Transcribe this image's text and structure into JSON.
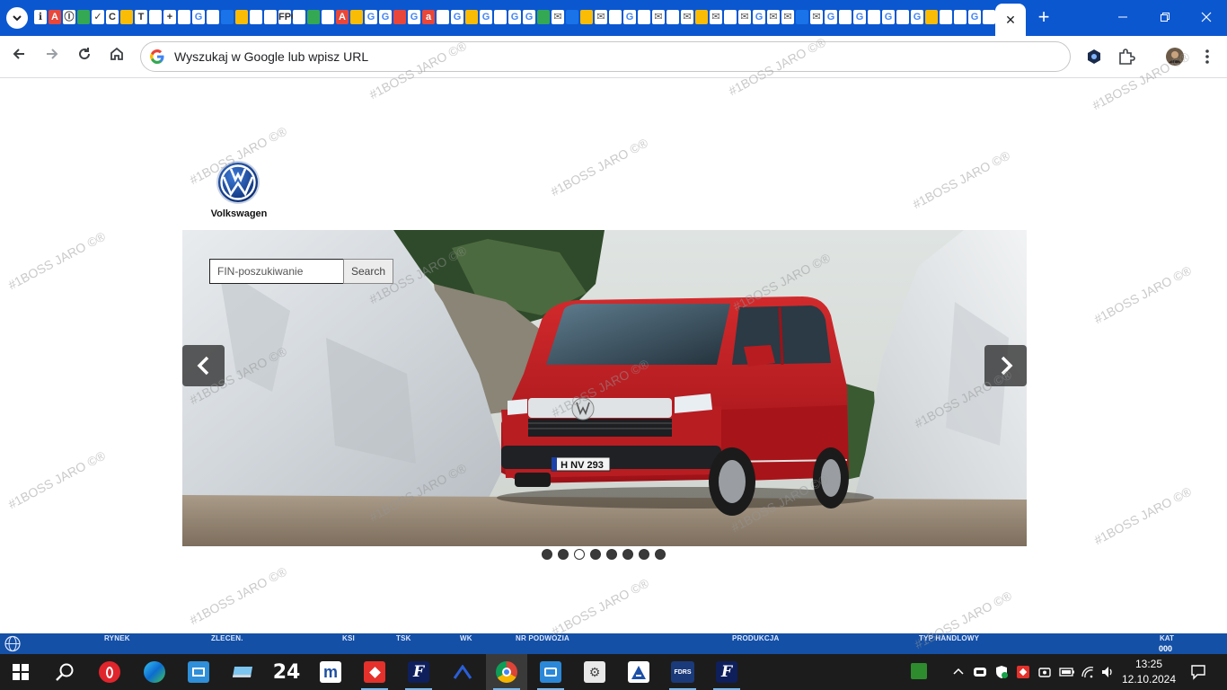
{
  "browser": {
    "address_bar_text": "Wyszukaj w Google lub wpisz URL",
    "tab_close": "✕",
    "new_tab": "+",
    "tab_favicons": [
      "ℹ",
      "A",
      "Ⓘ",
      "",
      "✓",
      "C",
      "",
      "T",
      "",
      "+",
      "",
      "G",
      "",
      "",
      "",
      "",
      "",
      "FPG",
      "",
      "",
      "",
      "A",
      "",
      "G",
      "G",
      "",
      "G",
      "a",
      "",
      "G",
      "",
      "G",
      "",
      "G",
      "G",
      "",
      "✉",
      "",
      "",
      "✉",
      "",
      "G",
      "",
      "✉",
      "",
      "✉",
      "",
      "✉",
      "",
      "✉",
      "G",
      "✉",
      "✉",
      "",
      "✉",
      "G",
      "",
      "G",
      "",
      "G",
      "",
      "G",
      "",
      "",
      "",
      "G",
      "",
      "",
      "",
      "G",
      "",
      "a",
      "o"
    ]
  },
  "page": {
    "brand_name": "Volkswagen",
    "search_placeholder": "FIN-poszukiwanie",
    "search_button": "Search",
    "carousel": {
      "slide_count": 8,
      "active_slide": 3,
      "plate_text": "H NV 293"
    }
  },
  "watermark": "#1BOSS JARO ©®",
  "status_bar": {
    "labels": [
      "RYNEK",
      "ZLECEN.",
      "KSI",
      "TSK",
      "WK",
      "NR PODWOZIA",
      "PRODUKCJA",
      "TYP HANDLOWY"
    ],
    "kat_label": "KAT",
    "kat_value": "000"
  },
  "taskbar": {
    "time": "13:25",
    "date": "12.10.2024",
    "apps": [
      "start",
      "search",
      "opera",
      "edge",
      "file-manager",
      "laptop-tool",
      "24",
      "m-app",
      "anydesk",
      "ford-etis",
      "vector-app",
      "chrome",
      "remote-desktop",
      "scheduler",
      "autodata",
      "fdrs",
      "ford-etis-2"
    ]
  },
  "colors": {
    "tabstrip": "#0b57d0",
    "statusbar": "#1450a6",
    "taskbar": "#1c1c1c",
    "van_red": "#c4181f"
  }
}
